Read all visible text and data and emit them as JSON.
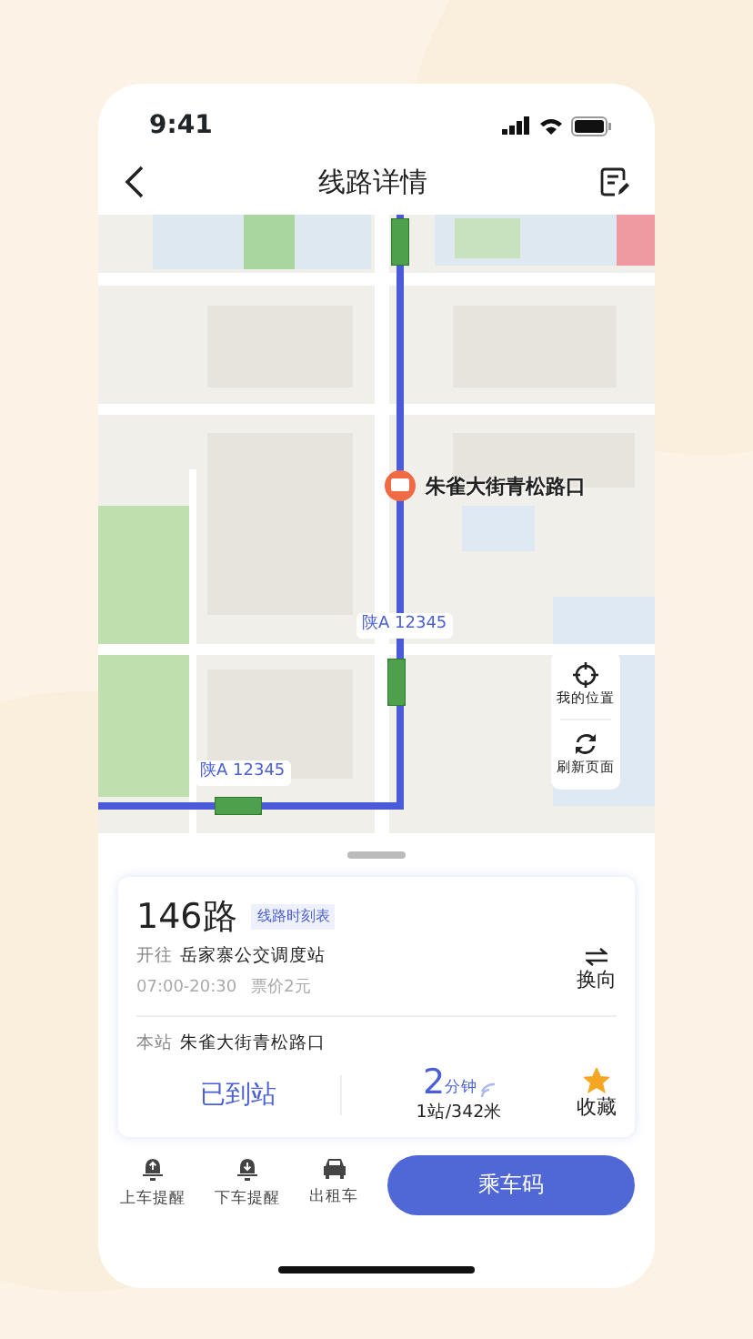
{
  "status_bar": {
    "time": "9:41"
  },
  "header": {
    "title": "线路详情"
  },
  "map": {
    "stop_label": "朱雀大街青松路口",
    "buses": [
      {
        "plate": "陕A 12345"
      },
      {
        "plate": "陕A 12345"
      }
    ],
    "controls": [
      {
        "kind": "locate",
        "label": "我的位置"
      },
      {
        "kind": "refresh",
        "label": "刷新页面"
      }
    ]
  },
  "line": {
    "name": "146路",
    "timetable_link": "线路时刻表",
    "direction_prefix": "开往",
    "destination": "岳家寨公交调度站",
    "hours": "07:00-20:30",
    "fare": "票价2元",
    "reverse": "换向",
    "station_prefix": "本站",
    "station": "朱雀大街青松路口",
    "arrived": "已到站",
    "eta_number": "2",
    "eta_unit": "分钟",
    "eta_distance": "1站/342米",
    "favorite": {
      "label": "收藏",
      "on": true
    }
  },
  "toolbar": [
    {
      "kind": "bell-up",
      "label": "上车提醒"
    },
    {
      "kind": "bell-down",
      "label": "下车提醒"
    },
    {
      "kind": "taxi",
      "label": "出租车"
    }
  ],
  "primary_button": "乘车码"
}
